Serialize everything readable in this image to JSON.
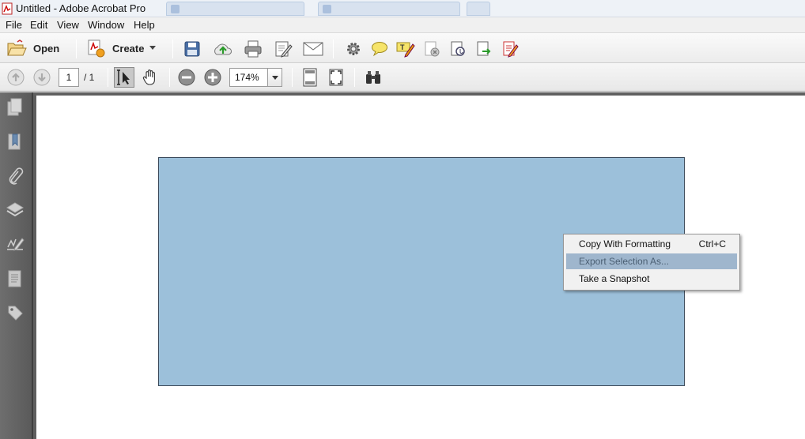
{
  "window": {
    "title": "Untitled - Adobe Acrobat Pro"
  },
  "menubar": {
    "items": [
      "File",
      "Edit",
      "View",
      "Window",
      "Help"
    ]
  },
  "toolbar": {
    "open_label": "Open",
    "create_label": "Create"
  },
  "navigation": {
    "page_number": "1",
    "page_total": "/ 1",
    "zoom_value": "174%"
  },
  "context_menu": {
    "items": [
      {
        "label": "Copy With Formatting",
        "shortcut": "Ctrl+C"
      },
      {
        "label": "Export Selection As...",
        "shortcut": ""
      },
      {
        "label": "Take a Snapshot",
        "shortcut": ""
      }
    ]
  },
  "colors": {
    "selection_fill": "#9cc0da",
    "menu_highlight": "#9fb6cd",
    "nav_panel": "#636363"
  }
}
